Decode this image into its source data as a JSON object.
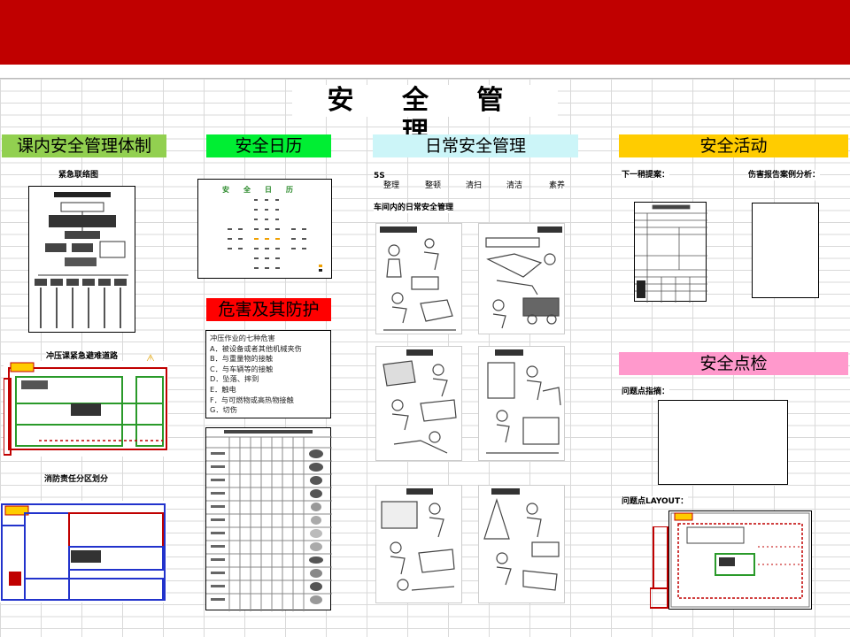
{
  "title": "安 全 管 理",
  "sections": {
    "system": {
      "label": "课内安全管理体制",
      "color": "#92d050"
    },
    "calendar": {
      "label": "安全日历",
      "color": "#00ee33"
    },
    "daily": {
      "label": "日常安全管理",
      "color": "#ccf5f8"
    },
    "activity": {
      "label": "安全活动",
      "color": "#ffcc00"
    },
    "hazard": {
      "label": "危害及其防护",
      "color": "#ff0000"
    },
    "inspection": {
      "label": "安全点检",
      "color": "#ff99cc"
    }
  },
  "system": {
    "contact_label": "紧急联络图",
    "evac_label": "冲压课紧急避难道路",
    "fire_label": "消防责任分区划分"
  },
  "calendar": {
    "heading": "安全日历"
  },
  "hazard_list": {
    "title": "冲压作业的七种危害",
    "items": [
      "A．被设备或者其他机械夹伤",
      "B．与重量物的接触",
      "C．与车辆等的接触",
      "D．坠落、摔到",
      "E．触电",
      "F．与可燃物或高热物接触",
      "G．切伤"
    ]
  },
  "daily": {
    "fives_label": "5S",
    "fives": [
      "整理",
      "整顿",
      "清扫",
      "清洁",
      "素养"
    ],
    "workshop_label": "车间内的日常安全管理"
  },
  "activity": {
    "proposal_label": "下一稍提案：",
    "injury_label": "伤害报告案例分析："
  },
  "inspection": {
    "problem_label": "问题点指摘：",
    "layout_label": "问题点LAYOUT："
  }
}
